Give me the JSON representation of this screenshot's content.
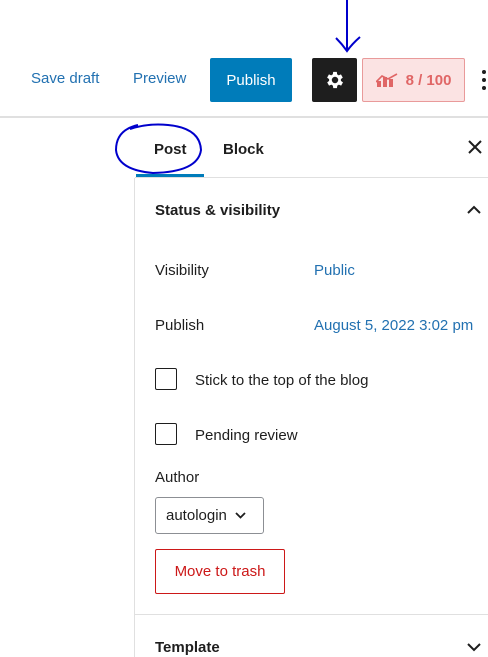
{
  "toolbar": {
    "save_draft": "Save draft",
    "preview": "Preview",
    "publish": "Publish",
    "score": "8 / 100"
  },
  "tabs": {
    "post": "Post",
    "block": "Block"
  },
  "status_section": {
    "title": "Status & visibility",
    "visibility_label": "Visibility",
    "visibility_value": "Public",
    "publish_label": "Publish",
    "publish_value": "August 5, 2022 3:02 pm",
    "sticky_label": "Stick to the top of the blog",
    "pending_label": "Pending review",
    "author_label": "Author",
    "author_value": "autologin",
    "trash_label": "Move to trash"
  },
  "template_section": {
    "title": "Template"
  },
  "colors": {
    "accent": "#007cba",
    "link": "#2271b1",
    "danger": "#cc1818",
    "score_bg": "#fbe3e3",
    "score_text": "#e06666",
    "annotation": "#0000cc"
  },
  "icons": [
    "gear-icon",
    "score-chart-icon",
    "more-options-icon",
    "close-icon",
    "chevron-up-icon",
    "chevron-down-icon"
  ]
}
